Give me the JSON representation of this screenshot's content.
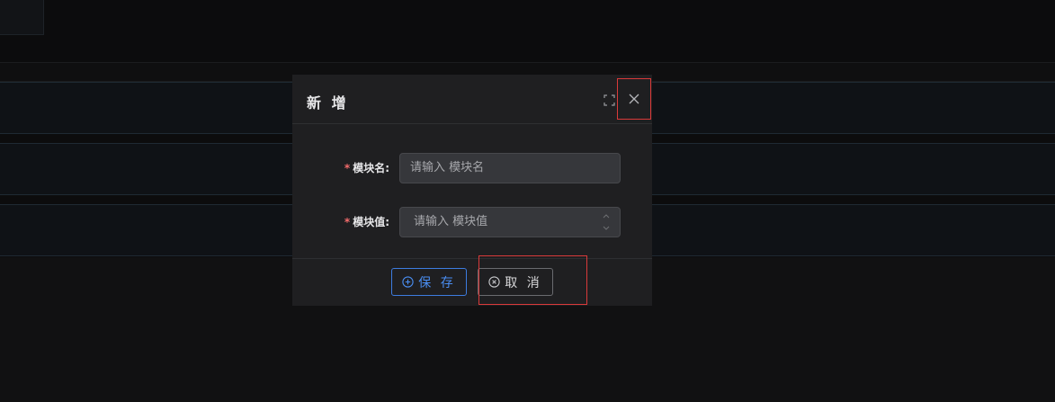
{
  "dialog": {
    "title": "新 增",
    "fullscreen_icon": "fullscreen-icon",
    "close_icon": "close-icon"
  },
  "form": {
    "fields": [
      {
        "required_mark": "*",
        "label": "模块名:",
        "placeholder": "请输入 模块名"
      },
      {
        "required_mark": "*",
        "label": "模块值:",
        "placeholder": "请输入 模块值"
      }
    ]
  },
  "footer": {
    "save_label": "保 存",
    "cancel_label": "取 消",
    "save_icon": "plus-circle-icon",
    "cancel_icon": "x-circle-icon"
  },
  "colors": {
    "primary": "#4a8ef2",
    "required": "#f56c6c",
    "highlight": "#d93a3a"
  }
}
